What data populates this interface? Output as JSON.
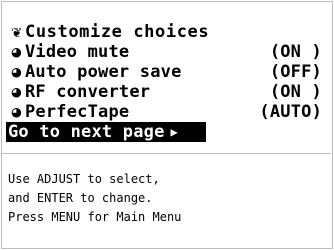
{
  "menu": {
    "title": {
      "icon": "gear-check-icon",
      "label": "Customize choices"
    },
    "items": [
      {
        "icon": "radio-arrow-icon",
        "label": "Video mute",
        "value": "(ON )"
      },
      {
        "icon": "radio-arrow-icon",
        "label": "Auto power save",
        "value": "(OFF)"
      },
      {
        "icon": "radio-arrow-icon",
        "label": "RF converter",
        "value": "(ON )"
      },
      {
        "icon": "radio-arrow-icon",
        "label": "PerfecTape",
        "value": "(AUTO)"
      }
    ],
    "next_page": {
      "label": "Go to next page",
      "icon": "right-triangle-icon"
    }
  },
  "help": {
    "line1": "Use ADJUST to select,",
    "line2": "and ENTER to change.",
    "line3": "Press MENU for Main Menu"
  },
  "colors": {
    "selection_bg": "#000000",
    "selection_fg": "#ffffff",
    "border": "#bdbdbd"
  }
}
